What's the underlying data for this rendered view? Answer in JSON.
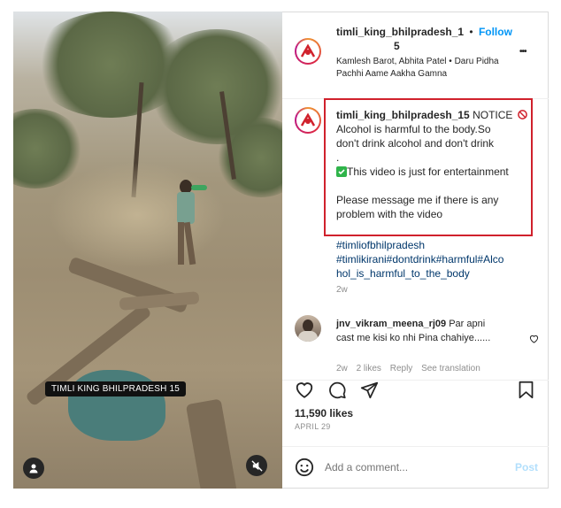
{
  "header": {
    "username": "timli_king_bhilpradesh_1",
    "username_wrap": "5",
    "follow_label": "Follow",
    "dot": "•",
    "audio": "Kamlesh Barot, Abhita Patel • Daru Pidha Pachhi Aame Aakha Gamna",
    "more_label": "•••"
  },
  "caption": {
    "username": "timli_king_bhilpradesh_15",
    "line1_after": "NOTICE",
    "line2": "Alcohol is harmful to the body.So",
    "line3": "don't drink alcohol and don't drink",
    "line4": ".",
    "line5": "This video is just for entertainment",
    "line6": "Please message me if there is any",
    "line7": "problem with the video",
    "hashtags": [
      "#timliofbhilpradesh",
      "#timlikirani#dontdrink#harmful#Alco",
      "hol_is_harmful_to_the_body"
    ],
    "age": "2w"
  },
  "comment": {
    "username": "jnv_vikram_meena_rj09",
    "text_a": "Par apni",
    "text_b": "cast me kisi ko nhi Pina chahiye......",
    "age": "2w",
    "likes": "2 likes",
    "reply": "Reply",
    "translate": "See translation"
  },
  "footer": {
    "likes": "11,590 likes",
    "date": "APRIL 29",
    "placeholder": "Add a comment...",
    "post_label": "Post"
  },
  "video": {
    "overlay_tag": "TIMLI KING BHILPRADESH 15"
  },
  "colors": {
    "follow_blue": "#0095f6",
    "hashtag_blue": "#00376b",
    "highlight_red": "#d0212c",
    "post_disabled": "#b2dffc"
  },
  "icons": [
    "user-icon",
    "mute-icon",
    "more-icon",
    "prohibited-icon",
    "check-icon",
    "heart-icon",
    "comment-icon",
    "share-icon",
    "bookmark-icon",
    "emoji-icon",
    "small-heart-icon"
  ]
}
